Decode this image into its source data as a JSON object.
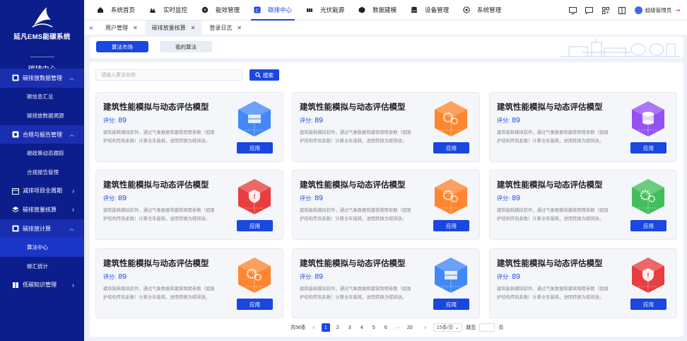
{
  "brand": {
    "title": "延凡EMS能碳系统",
    "system": "碳排中心"
  },
  "sidebar": {
    "items": [
      {
        "label": "碳排放数据管理",
        "icon": "grid-icon",
        "type": "group",
        "open": true
      },
      {
        "label": "碳信息汇总",
        "type": "sub"
      },
      {
        "label": "碳排放数据溯源",
        "type": "sub"
      },
      {
        "label": "合规与报告管理",
        "icon": "shield-icon",
        "type": "group",
        "open": true
      },
      {
        "label": "碳政策动态跟踪",
        "type": "sub"
      },
      {
        "label": "合规报告管理",
        "type": "sub"
      },
      {
        "label": "减排项目全周期",
        "icon": "calendar-icon",
        "type": "group",
        "open": false
      },
      {
        "label": "碳排放量核算",
        "icon": "layers-icon",
        "type": "group",
        "open": false
      },
      {
        "label": "碳排放计算",
        "icon": "grid-icon",
        "type": "group",
        "open": true
      },
      {
        "label": "算法中心",
        "type": "sub",
        "active": true
      },
      {
        "label": "碳汇统计",
        "type": "sub"
      },
      {
        "label": "低碳知识管理",
        "icon": "book-icon",
        "type": "group",
        "open": false
      }
    ]
  },
  "topnav": {
    "items": [
      {
        "label": "系统首页",
        "icon": "home-icon"
      },
      {
        "label": "实时监控",
        "icon": "monitor-icon"
      },
      {
        "label": "能效管理",
        "icon": "efficiency-icon"
      },
      {
        "label": "碳排中心",
        "icon": "carbon-icon",
        "active": true
      },
      {
        "label": "光伏能源",
        "icon": "solar-icon"
      },
      {
        "label": "数据建模",
        "icon": "model-icon"
      },
      {
        "label": "设备管理",
        "icon": "device-icon"
      },
      {
        "label": "系统管理",
        "icon": "settings-icon"
      }
    ],
    "user": "超级管理员"
  },
  "tabs": [
    {
      "label": "用户管理"
    },
    {
      "label": "碳排放量核算",
      "active": true
    },
    {
      "label": "登录日志"
    }
  ],
  "subtabs": {
    "market": "算法市场",
    "mine": "我的算法"
  },
  "search": {
    "placeholder": "请输入算法名称",
    "button": "搜索"
  },
  "cards": [
    {
      "title": "建筑性能模拟与动态评估模型",
      "score_label": "评分:",
      "score": "89",
      "desc": "建筑能耗模拟软件，通过气象数据和建筑物理参数（如围护结构传热系数）计算全年能耗，进而转换为碳排放。",
      "button": "应用",
      "art_color": "#2f7cf6",
      "art_icon": "server-icon"
    },
    {
      "title": "建筑性能模拟与动态评估模型",
      "score_label": "评分:",
      "score": "89",
      "desc": "建筑能耗模拟软件，通过气象数据和建筑物理参数（如围护结构传热系数）计算全年能耗，进而转换为碳排放。",
      "button": "应用",
      "art_color": "#ff7a1a",
      "art_icon": "gears-icon"
    },
    {
      "title": "建筑性能模拟与动态评估模型",
      "score_label": "评分:",
      "score": "89",
      "desc": "建筑能耗模拟软件，通过气象数据和建筑物理参数（如围护结构传热系数）计算全年能耗，进而转换为碳排放。",
      "button": "应用",
      "art_color": "#8b3ff2",
      "art_icon": "database-icon"
    },
    {
      "title": "建筑性能模拟与动态评估模型",
      "score_label": "评分:",
      "score": "89",
      "desc": "建筑能耗模拟软件，通过气象数据和建筑物理参数（如围护结构传热系数）计算全年能耗，进而转换为碳排放。",
      "button": "应用",
      "art_color": "#e52a2a",
      "art_icon": "shield-warning-icon"
    },
    {
      "title": "建筑性能模拟与动态评估模型",
      "score_label": "评分:",
      "score": "89",
      "desc": "建筑能耗模拟软件，通过气象数据和建筑物理参数（如围护结构传热系数）计算全年能耗，进而转换为碳排放。",
      "button": "应用",
      "art_color": "#ff7a1a",
      "art_icon": "gears-icon"
    },
    {
      "title": "建筑性能模拟与动态评估模型",
      "score_label": "评分:",
      "score": "89",
      "desc": "建筑能耗模拟软件，通过气象数据和建筑物理参数（如围护结构传热系数）计算全年能耗，进而转换为碳排放。",
      "button": "应用",
      "art_color": "#2fb84a",
      "art_icon": "gears-icon"
    },
    {
      "title": "建筑性能模拟与动态评估模型",
      "score_label": "评分:",
      "score": "89",
      "desc": "建筑能耗模拟软件，通过气象数据和建筑物理参数（如围护结构传热系数）计算全年能耗，进而转换为碳排放。",
      "button": "应用",
      "art_color": "#ff7a1a",
      "art_icon": "gears-icon"
    },
    {
      "title": "建筑性能模拟与动态评估模型",
      "score_label": "评分:",
      "score": "89",
      "desc": "建筑能耗模拟软件，通过气象数据和建筑物理参数（如围护结构传热系数）计算全年能耗，进而转换为碳排放。",
      "button": "应用",
      "art_color": "#2f7cf6",
      "art_icon": "server-icon"
    },
    {
      "title": "建筑性能模拟与动态评估模型",
      "score_label": "评分:",
      "score": "89",
      "desc": "建筑能耗模拟软件，通过气象数据和建筑物理参数（如围护结构传热系数）计算全年能耗，进而转换为碳排放。",
      "button": "应用",
      "art_color": "#e52a2a",
      "art_icon": "shield-warning-icon"
    }
  ],
  "pagination": {
    "total": "共56条",
    "pages": [
      "1",
      "2",
      "3",
      "4",
      "5",
      "6",
      "···",
      "20"
    ],
    "size": "15条/页",
    "jump": "跳至",
    "unit": "页",
    "current": "1"
  },
  "colors": {
    "sidebar": "#0b1e8c",
    "accent": "#1a47e0"
  }
}
